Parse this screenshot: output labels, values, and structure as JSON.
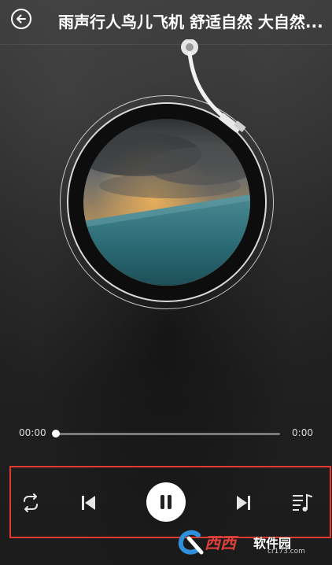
{
  "header": {
    "title": "雨声行人鸟儿飞机 舒适自然 大自然..."
  },
  "player": {
    "progress_fraction": 0.0
  },
  "progress": {
    "current_time": "00:00",
    "total_time": "0:00"
  },
  "controls": {
    "icons": [
      "repeat-icon",
      "previous-icon",
      "pause-icon",
      "next-icon",
      "playlist-icon"
    ]
  },
  "watermark": {
    "brand_red": "西西",
    "brand_white": "软件园",
    "domain": "cr173.com"
  },
  "colors": {
    "highlight_border": "#e43a2d",
    "background": "#1b1b1b"
  }
}
